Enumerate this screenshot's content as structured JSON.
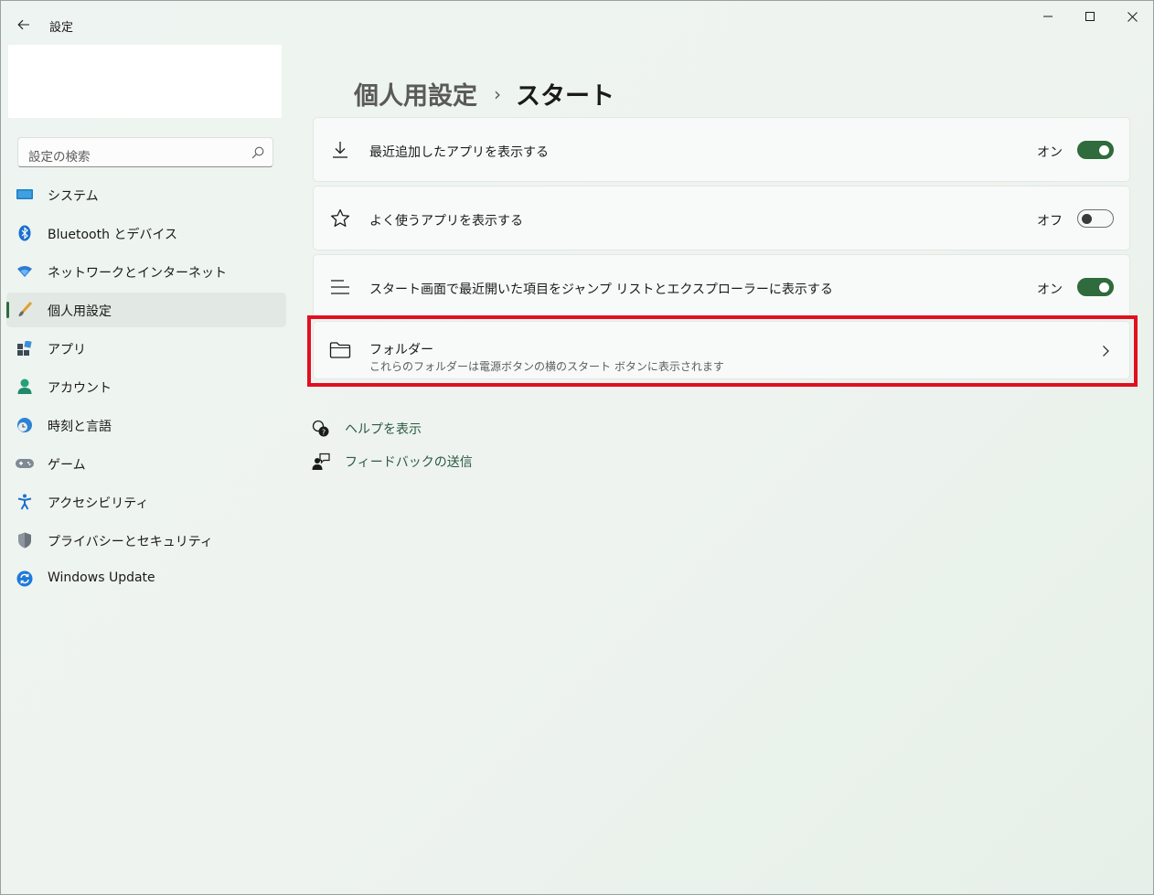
{
  "window": {
    "title": "設定"
  },
  "search": {
    "placeholder": "設定の検索"
  },
  "sidebar": {
    "items": [
      {
        "label": "システム",
        "icon": "system-monitor-icon"
      },
      {
        "label": "Bluetooth とデバイス",
        "icon": "bluetooth-icon"
      },
      {
        "label": "ネットワークとインターネット",
        "icon": "network-wifi-icon"
      },
      {
        "label": "個人用設定",
        "icon": "personalization-brush-icon",
        "selected": true
      },
      {
        "label": "アプリ",
        "icon": "apps-icon"
      },
      {
        "label": "アカウント",
        "icon": "account-person-icon"
      },
      {
        "label": "時刻と言語",
        "icon": "time-language-icon"
      },
      {
        "label": "ゲーム",
        "icon": "gamepad-icon"
      },
      {
        "label": "アクセシビリティ",
        "icon": "accessibility-icon"
      },
      {
        "label": "プライバシーとセキュリティ",
        "icon": "shield-icon"
      },
      {
        "label": "Windows Update",
        "icon": "windows-update-icon"
      }
    ]
  },
  "breadcrumb": {
    "parent": "個人用設定",
    "separator": "›",
    "current": "スタート"
  },
  "settings": {
    "recent_apps": {
      "label": "最近追加したアプリを表示する",
      "state": "オン",
      "on": true
    },
    "frequent_apps": {
      "label": "よく使うアプリを表示する",
      "state": "オフ",
      "on": false
    },
    "recent_items": {
      "label": "スタート画面で最近開いた項目をジャンプ リストとエクスプローラーに表示する",
      "state": "オン",
      "on": true
    },
    "folders": {
      "title": "フォルダー",
      "subtitle": "これらのフォルダーは電源ボタンの横のスタート ボタンに表示されます"
    }
  },
  "links": {
    "help": "ヘルプを表示",
    "feedback": "フィードバックの送信"
  },
  "colors": {
    "accent": "#2f6b3c",
    "highlight": "#e01020",
    "link": "#2a5a40"
  }
}
